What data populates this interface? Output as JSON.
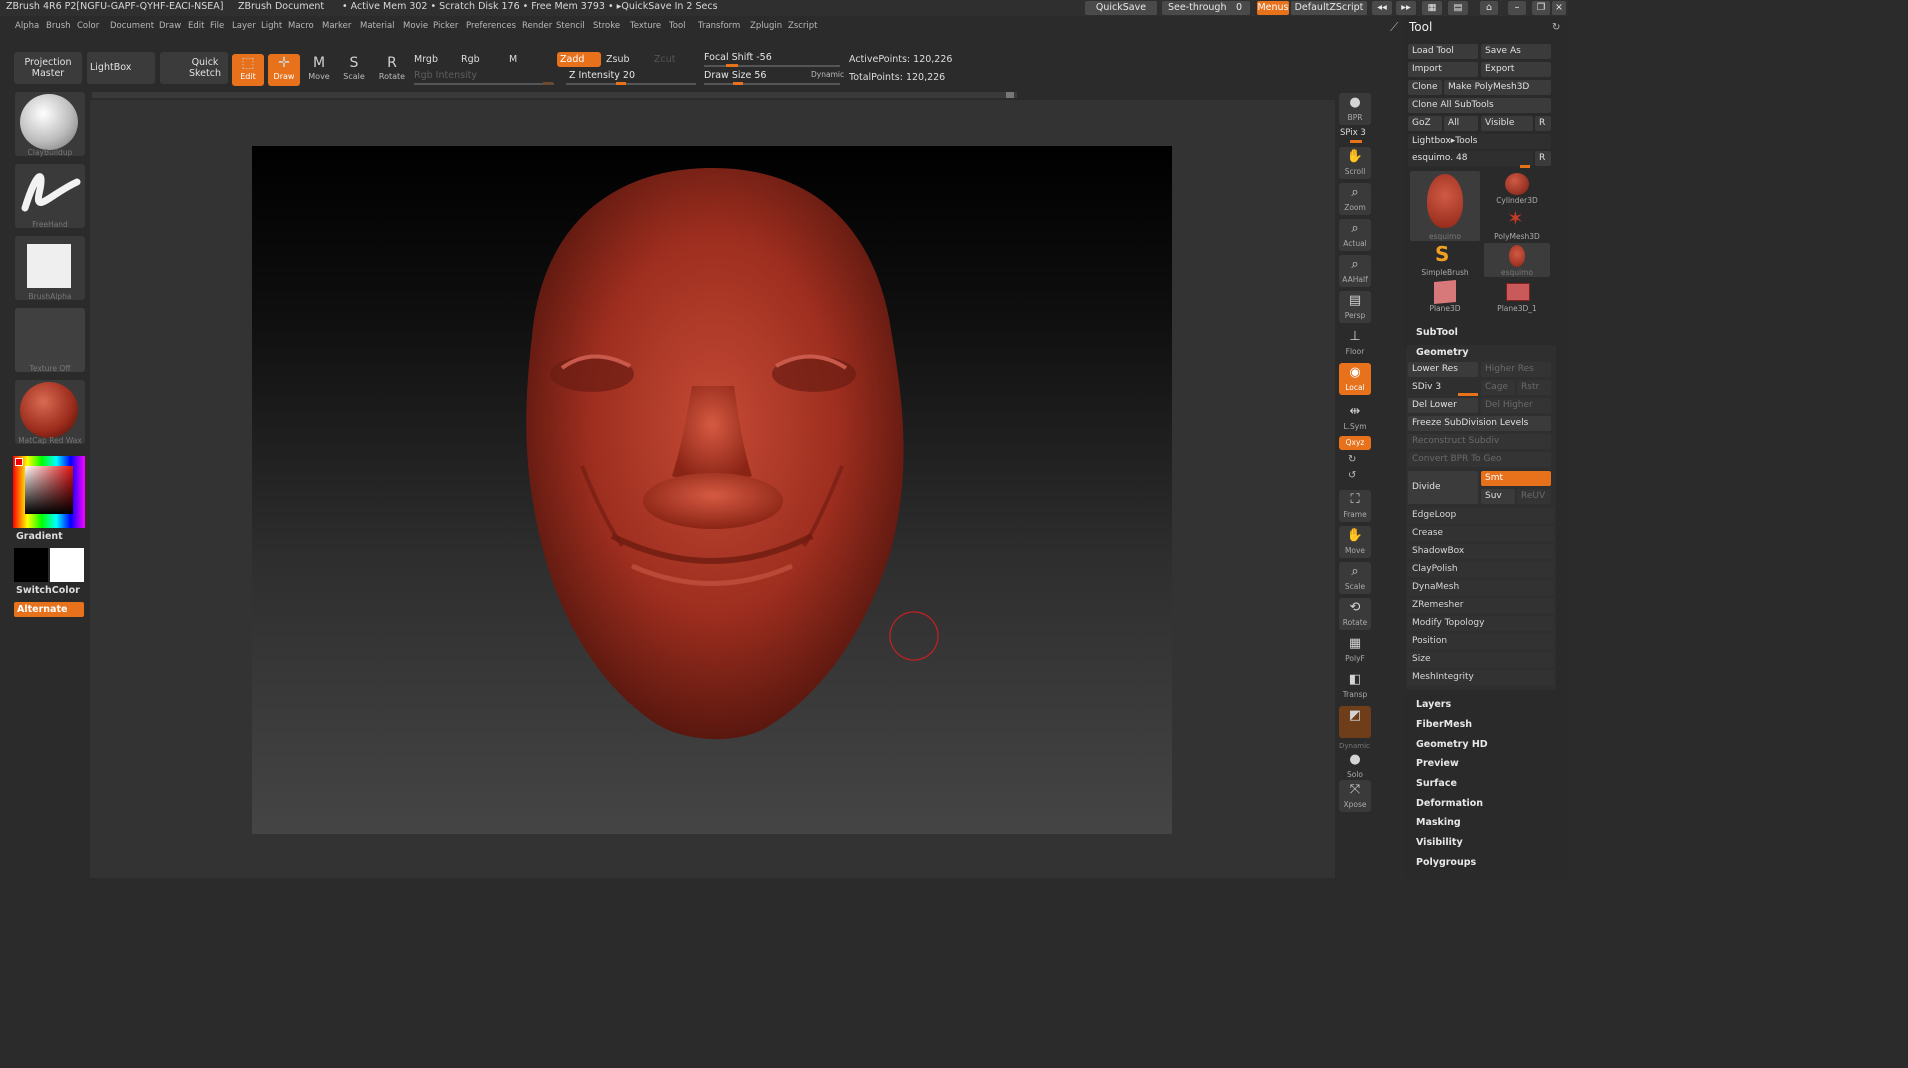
{
  "title": {
    "app": "ZBrush 4R6 P2[NGFU-GAPF-QYHF-EACI-NSEA]",
    "doc": "ZBrush Document",
    "mem": "• Active Mem 302 • Scratch Disk 176 • Free Mem 3793 • ▸QuickSave In 2 Secs",
    "quicksave": "QuickSave",
    "seethrough": "See-through",
    "seethrough_val": "0",
    "menus": "Menus",
    "script": "DefaultZScript"
  },
  "menu": [
    "Alpha",
    "Brush",
    "Color",
    "Document",
    "Draw",
    "Edit",
    "File",
    "Layer",
    "Light",
    "Macro",
    "Marker",
    "Material",
    "Movie",
    "Picker",
    "Preferences",
    "Render",
    "Stencil",
    "Stroke",
    "Texture",
    "Tool",
    "Transform",
    "Zplugin",
    "Zscript"
  ],
  "shelf": {
    "projection_master": "Projection Master",
    "lightbox": "LightBox",
    "quick_sketch": "Quick Sketch",
    "edit": "Edit",
    "draw": "Draw",
    "move": "Move",
    "scale": "Scale",
    "rotate": "Rotate",
    "mrgb": "Mrgb",
    "rgb": "Rgb",
    "m": "M",
    "zadd": "Zadd",
    "zsub": "Zsub",
    "zcut": "Zcut",
    "rgb_intensity": "Rgb Intensity",
    "z_intensity": "Z Intensity 20",
    "focal_shift": "Focal Shift -56",
    "draw_size": "Draw Size 56",
    "dynamic": "Dynamic",
    "active_points": "ActivePoints: 120,226",
    "total_points": "TotalPoints: 120,226"
  },
  "left": {
    "brush": "ClayBuildup",
    "stroke": "FreeHand",
    "alpha": "BrushAlpha",
    "texture": "Texture Off",
    "material": "MatCap Red Wax",
    "gradient": "Gradient",
    "switchcolor": "SwitchColor",
    "alternate": "Alternate"
  },
  "right": {
    "bpr": "BPR",
    "spix": "SPix 3",
    "scroll": "Scroll",
    "zoom": "Zoom",
    "actual": "Actual",
    "aahalf": "AAHalf",
    "persp": "Persp",
    "floor": "Floor",
    "local": "Local",
    "lsym": "L.Sym",
    "xyz": "Qxyz",
    "frame": "Frame",
    "move": "Move",
    "scale": "Scale",
    "rotate": "Rotate",
    "polyf": "PolyF",
    "transp": "Transp",
    "dynamic": "Dynamic",
    "solo": "Solo",
    "xpose": "Xpose"
  },
  "tool": {
    "header": "Tool",
    "load_tool": "Load Tool",
    "save_as": "Save As",
    "import": "Import",
    "export": "Export",
    "clone": "Clone",
    "make_polymesh": "Make PolyMesh3D",
    "clone_all": "Clone All SubTools",
    "goz": "GoZ",
    "all": "All",
    "visible": "Visible",
    "r": "R",
    "lightbox_tools": "Lightbox▸Tools",
    "current": "esquimo. 48",
    "thumbs": [
      "esquimo",
      "Cylinder3D",
      "PolyMesh3D",
      "SimpleBrush",
      "esquimo",
      "Plane3D",
      "Plane3D_1"
    ],
    "subtool": "SubTool",
    "geometry": "Geometry",
    "lower_res": "Lower Res",
    "higher_res": "Higher Res",
    "sdiv": "SDiv 3",
    "cage": "Cage",
    "rstr": "Rstr",
    "del_lower": "Del Lower",
    "del_higher": "Del Higher",
    "freeze": "Freeze SubDivision Levels",
    "reconstruct": "Reconstruct Subdiv",
    "convert_bpr": "Convert BPR To Geo",
    "divide": "Divide",
    "smt": "Smt",
    "suv": "Suv",
    "reuv": "ReUV",
    "geo_items": [
      "EdgeLoop",
      "Crease",
      "ShadowBox",
      "ClayPolish",
      "DynaMesh",
      "ZRemesher",
      "Modify Topology",
      "Position",
      "Size",
      "MeshIntegrity"
    ],
    "sections": [
      "Layers",
      "FiberMesh",
      "Geometry HD",
      "Preview",
      "Surface",
      "Deformation",
      "Masking",
      "Visibility",
      "Polygroups"
    ]
  }
}
